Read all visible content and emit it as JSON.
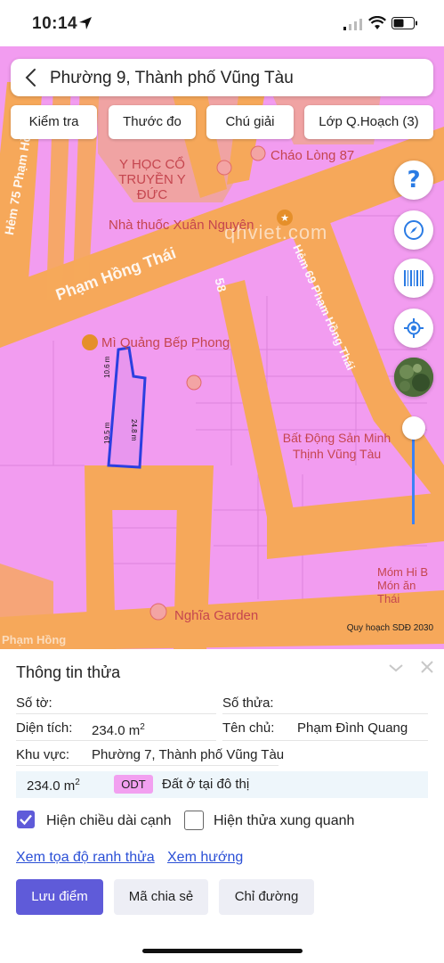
{
  "status_bar": {
    "time": "10:14"
  },
  "header": {
    "title": "Phường 9, Thành phố Vũng Tàu"
  },
  "toolbar": {
    "check_label": "Kiểm tra",
    "measure_label": "Thước đo",
    "legend_label": "Chú giải",
    "layers_label": "Lớp Q.Hoạch (3)"
  },
  "map": {
    "road_main": "Phạm Hồng Thái",
    "road_alley": "Hẻm 75 Phạm Hồng",
    "road_side": "Hẻm 69 Phạm Hồng Thái",
    "road_short": "58",
    "alley_bottom": "Phạm Hồng",
    "watermark": "qhviet.com",
    "poi": [
      "Y HỌC CỔ TRUYỀN Y ĐỨC",
      "Cháo Lòng 87",
      "Nhà thuốc Xuân Nguyên",
      "Mì Quảng Bếp Phong",
      "Bất Động Sản Minh Thịnh Vũng Tàu",
      "Móm Hi B Món ăn Thái",
      "Nghĩa Garden"
    ],
    "parcel_edges": [
      "10.6 m",
      "19.5 m",
      "24.8 m"
    ],
    "attribution": "Quy hoạch SDĐ 2030",
    "colors": {
      "residential": "#f29cf0",
      "road": "#f6a85a",
      "commercial": "#f0a3a3",
      "parcel_outline": "#2b3fe0"
    }
  },
  "sheet": {
    "title": "Thông tin thửa",
    "sheet_no_label": "Số tờ:",
    "parcel_no_label": "Số thửa:",
    "area_label": "Diện tích:",
    "area_value": "234.0 m",
    "area_unit_sup": "2",
    "owner_label": "Tên chủ:",
    "owner_value": "Phạm Đình Quang",
    "region_label": "Khu vực:",
    "region_value": "Phường 7, Thành phố Vũng Tàu",
    "land_area": "234.0 m",
    "land_code": "ODT",
    "land_type": "Đất ở tại đô thị",
    "show_edge_length": "Hiện chiều dài cạnh",
    "show_edge_length_checked": true,
    "show_nearby": "Hiện thửa xung quanh",
    "show_nearby_checked": false,
    "link_coords": "Xem tọa độ ranh thửa",
    "link_direction": "Xem hướng",
    "btn_save": "Lưu điểm",
    "btn_share": "Mã chia sẻ",
    "btn_route": "Chỉ đường"
  }
}
